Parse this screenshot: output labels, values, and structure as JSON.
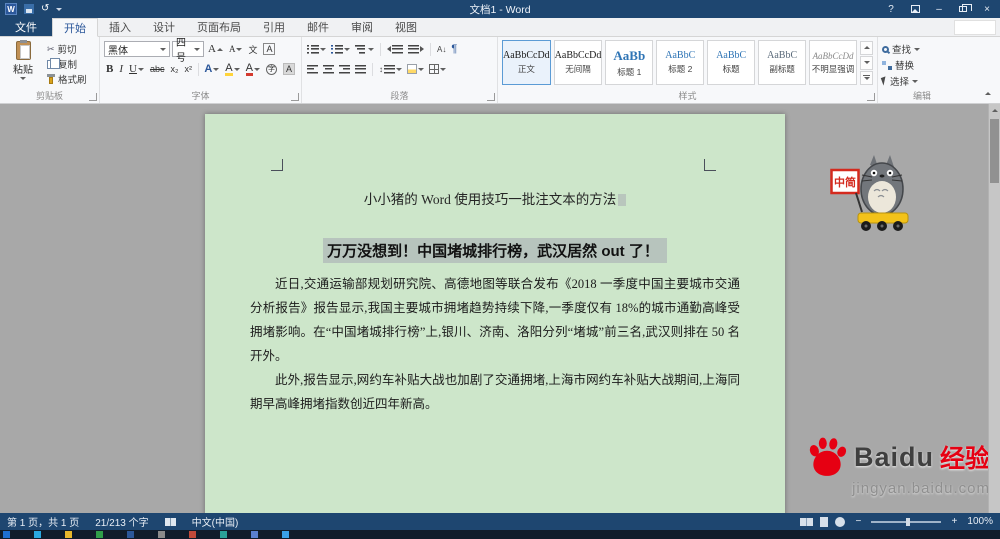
{
  "titlebar": {
    "title": "文档1 - Word",
    "help_icon": "?",
    "undo_icon": "↺",
    "min_icon": "–",
    "close_icon": "×"
  },
  "tabs": {
    "file": "文件",
    "items": [
      {
        "label": "开始"
      },
      {
        "label": "插入"
      },
      {
        "label": "设计"
      },
      {
        "label": "页面布局"
      },
      {
        "label": "引用"
      },
      {
        "label": "邮件"
      },
      {
        "label": "审阅"
      },
      {
        "label": "视图"
      }
    ]
  },
  "clipboard": {
    "group_label": "剪贴板",
    "paste_label": "粘贴",
    "cut_label": "剪切",
    "cut_icon": "✂",
    "copy_label": "复制",
    "painter_label": "格式刷"
  },
  "font": {
    "group_label": "字体",
    "name_value": "黑体",
    "size_value": "四号",
    "grow_icon": "A",
    "shrink_icon": "A",
    "phonetic_icon": "文",
    "charborder_icon": "A",
    "bold_icon": "B",
    "italic_icon": "I",
    "underline_icon": "U",
    "strike_icon": "abc",
    "subscript_icon": "x₂",
    "superscript_icon": "x²",
    "effects_icon": "A",
    "highlight_icon": "A",
    "fontcolor_icon": "A",
    "circlechar_icon": "字",
    "charshading_icon": "A"
  },
  "paragraph": {
    "group_label": "段落",
    "sort_icon": "A↓",
    "pilcrow_icon": "¶",
    "spacing_icon": "↕"
  },
  "styles": {
    "group_label": "样式",
    "items": [
      {
        "preview": "AaBbCcDd",
        "name": "正文"
      },
      {
        "preview": "AaBbCcDd",
        "name": "无间隔"
      },
      {
        "preview": "AaBb",
        "name": "标题 1"
      },
      {
        "preview": "AaBbC",
        "name": "标题 2"
      },
      {
        "preview": "AaBbC",
        "name": "标题"
      },
      {
        "preview": "AaBbC",
        "name": "副标题"
      },
      {
        "preview": "AaBbCcDd",
        "name": "不明显强调"
      }
    ]
  },
  "editing": {
    "group_label": "编辑",
    "find_label": "查找",
    "replace_label": "替换",
    "select_label": "选择"
  },
  "document": {
    "title": "小小猪的 Word 使用技巧一批注文本的方法",
    "heading": "万万没想到！中国堵城排行榜，武汉居然 out 了！",
    "para1": "近日,交通运输部规划研究院、高德地图等联合发布《2018 一季度中国主要城市交通分析报告》报告显示,我国主要城市拥堵趋势持续下降,一季度仅有 18%的城市通勤高峰受拥堵影响。在“中国堵城排行榜”上,银川、济南、洛阳分列“堵城”前三名,武汉则排在 50 名开外。",
    "para2": "此外,报告显示,网约车补贴大战也加剧了交通拥堵,上海市网约车补贴大战期间,上海同期早高峰拥堵指数创近四年新高。"
  },
  "mascot": {
    "sign_text": "中简"
  },
  "brand": {
    "latin": "Baidu",
    "cn": "经验",
    "url": "jingyan.baidu.com",
    "red": "#e60012"
  },
  "statusbar": {
    "page_info": "第 1 页，共 1 页",
    "word_count": "21/213 个字",
    "language": "中文(中国)",
    "zoom_out": "−",
    "zoom_in": "+",
    "zoom_value": "100%"
  },
  "colors": {
    "titlebar": "#1e4670",
    "accent": "#2b579a",
    "page_green": "#cde6ca",
    "selection_gray": "#b7c4bd"
  }
}
